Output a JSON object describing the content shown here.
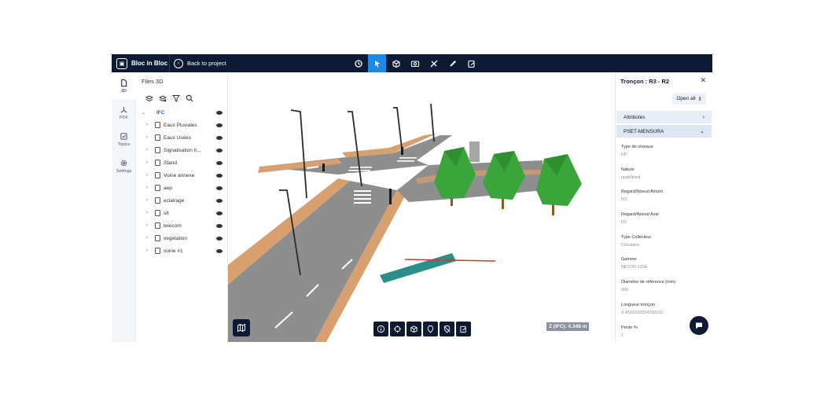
{
  "topbar": {
    "brand": "Bloc in Bloc",
    "back_label": "Back to project",
    "tools": [
      "history-icon",
      "select-icon",
      "cube-icon",
      "camera-icon",
      "measure-icon",
      "pen-icon",
      "edit-icon"
    ],
    "active_tool": "select-icon"
  },
  "rail": {
    "items": [
      {
        "label": "3D",
        "icon": "file-icon"
      },
      {
        "label": "PDF",
        "icon": "pdf-icon"
      },
      {
        "label": "Topics",
        "icon": "topics-icon"
      },
      {
        "label": "Settings",
        "icon": "gear-icon"
      }
    ]
  },
  "files": {
    "title": "Files 3D",
    "root": "IFC",
    "items": [
      "Eaux Pluviales",
      "Eaux Usées",
      "Signalisation h...",
      "Stand",
      "Voirie annexe",
      "aep",
      "eclairage",
      "slt",
      "telecom",
      "vegetation",
      "voirie #1"
    ]
  },
  "viewport": {
    "z_badge": "Z (IFC): 4.348 m"
  },
  "panel": {
    "title": "Tronçon : R3 - R2",
    "open_all": "Open all",
    "sections": [
      "Attributes",
      "PSET-MENSURA"
    ],
    "properties": [
      {
        "key": "Type de réseaux",
        "value": "EP"
      },
      {
        "key": "Nature",
        "value": "undefined"
      },
      {
        "key": "Regard/Noeud Amont",
        "value": "R3"
      },
      {
        "key": "Regard/Noeud Aval",
        "value": "R2"
      },
      {
        "key": "Type Collecteur",
        "value": "Circulaire"
      },
      {
        "key": "Gamme",
        "value": "BETON 135A"
      },
      {
        "key": "Diamètre de référence (mm)",
        "value": "500"
      },
      {
        "key": "Longueur tronçon",
        "value": "9.4593310034782032"
      },
      {
        "key": "Pente %",
        "value": "1"
      }
    ]
  },
  "colors": {
    "topbar": "#0e1a33",
    "accent": "#1e88e5",
    "road": "#8e8e8e",
    "sidewalk": "#d9a06f",
    "tree": "#3aa53a",
    "pipe": "#2a8f89"
  }
}
